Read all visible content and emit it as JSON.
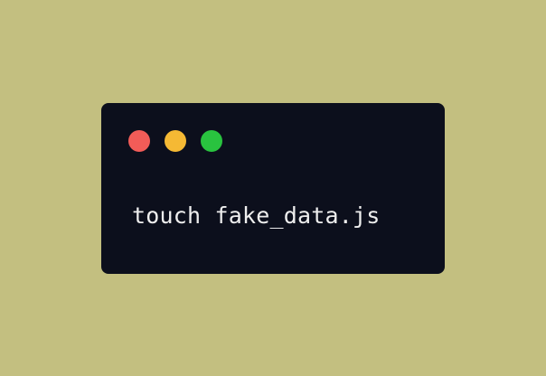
{
  "colors": {
    "background": "#c3bf80",
    "terminal_background": "#0c0f1c",
    "text": "#eeeeee",
    "close": "#f25c58",
    "minimize": "#f5b934",
    "maximize": "#29c33f"
  },
  "terminal": {
    "command": "touch fake_data.js",
    "controls": [
      {
        "name": "close",
        "color_key": "close"
      },
      {
        "name": "minimize",
        "color_key": "minimize"
      },
      {
        "name": "maximize",
        "color_key": "maximize"
      }
    ]
  }
}
